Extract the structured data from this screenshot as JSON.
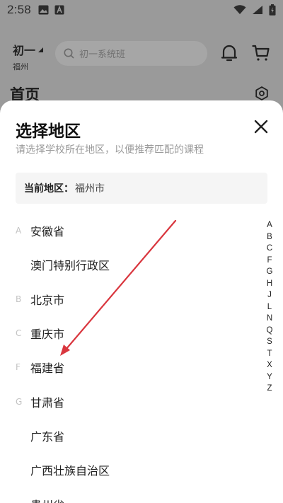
{
  "status_bar": {
    "time": "2:58"
  },
  "header": {
    "grade": "初一",
    "city": "福州",
    "search_placeholder": "初一系统班"
  },
  "page_title": "首页",
  "sheet": {
    "title": "选择地区",
    "subtitle": "请选择学校所在地区，以便推荐匹配的课程",
    "current_label": "当前地区：",
    "current_value": "福州市"
  },
  "regions": [
    {
      "letter": "A",
      "name": "安徽省"
    },
    {
      "letter": "",
      "name": "澳门特别行政区"
    },
    {
      "letter": "B",
      "name": "北京市"
    },
    {
      "letter": "C",
      "name": "重庆市"
    },
    {
      "letter": "F",
      "name": "福建省"
    },
    {
      "letter": "G",
      "name": "甘肃省"
    },
    {
      "letter": "",
      "name": "广东省"
    },
    {
      "letter": "",
      "name": "广西壮族自治区"
    },
    {
      "letter": "",
      "name": "贵州省"
    }
  ],
  "index_letters": [
    "A",
    "B",
    "C",
    "F",
    "G",
    "H",
    "J",
    "L",
    "N",
    "Q",
    "S",
    "T",
    "X",
    "Y",
    "Z"
  ],
  "colors": {
    "accent_arrow": "#d9363e"
  }
}
